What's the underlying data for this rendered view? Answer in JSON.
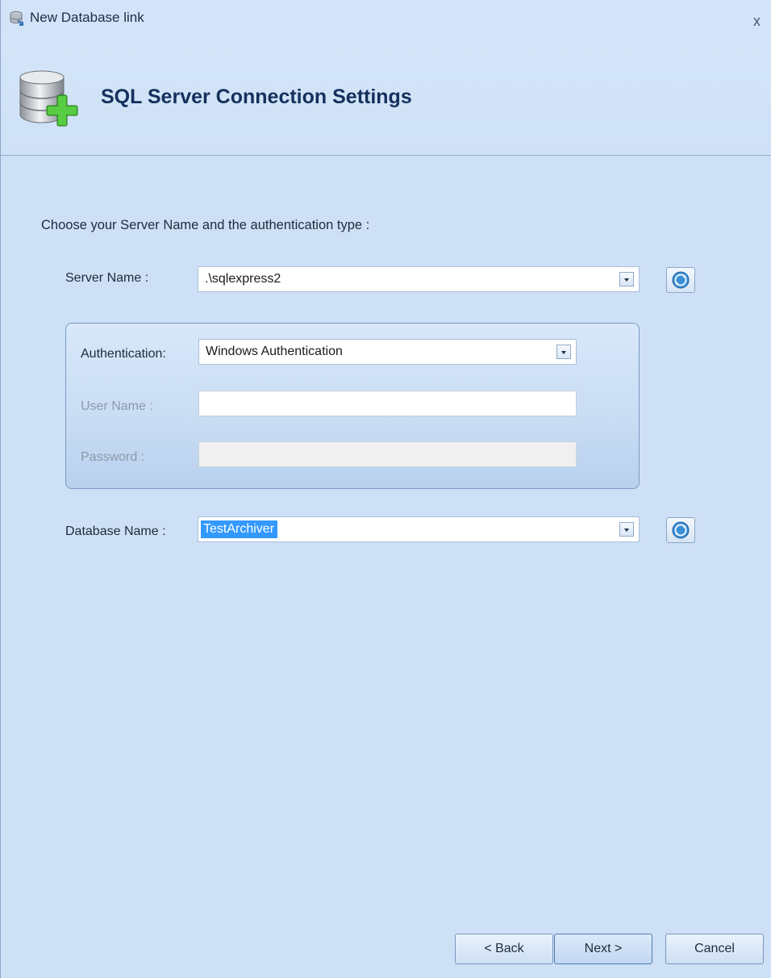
{
  "window": {
    "title": "New Database link",
    "close_label": "x"
  },
  "header": {
    "title": "SQL Server Connection Settings"
  },
  "form": {
    "instruction": "Choose your Server Name and the authentication type :",
    "server_name": {
      "label": "Server Name :",
      "value": ".\\sqlexpress2"
    },
    "authentication": {
      "label": "Authentication:",
      "value": "Windows Authentication"
    },
    "user_name": {
      "label": "User Name :",
      "value": ""
    },
    "password": {
      "label": "Password :",
      "value": ""
    },
    "database_name": {
      "label": "Database Name :",
      "value": "TestArchiver"
    }
  },
  "buttons": {
    "back": "< Back",
    "next": "Next >",
    "cancel": "Cancel"
  },
  "icons": {
    "title": "database-link-icon",
    "header": "database-add-icon",
    "refresh": "refresh-icon",
    "dropdown": "chevron-down-icon"
  }
}
